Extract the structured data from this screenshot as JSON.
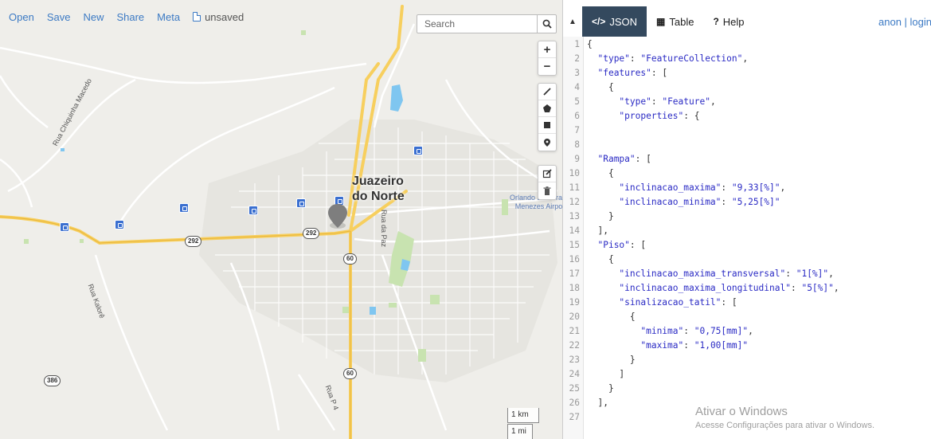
{
  "topbar": {
    "open": "Open",
    "save": "Save",
    "new": "New",
    "share": "Share",
    "meta": "Meta",
    "status": "unsaved"
  },
  "search": {
    "placeholder": "Search"
  },
  "map": {
    "city_line1": "Juazeiro",
    "city_line2": "do Norte",
    "streets": {
      "chiquinha": "Rua Chiquinha Macedo",
      "kalore": "Rua Kalorê",
      "paz": "Rua da Paz",
      "p4": "Rua P 4"
    },
    "place_line1": "Orlando Bezerra de",
    "place_line2": "Menezes Airport",
    "shields": [
      "292",
      "292",
      "60",
      "60",
      "386"
    ],
    "scale_km": "1 km",
    "scale_mi": "1 mi",
    "zoom_in": "+",
    "zoom_out": "−"
  },
  "side": {
    "tabs": [
      {
        "icon": "</>",
        "label": "JSON"
      },
      {
        "icon": "▦",
        "label": "Table"
      },
      {
        "icon": "?",
        "label": "Help"
      }
    ],
    "user": "anon | login"
  },
  "editor_lines": [
    "{",
    "  \"type\": \"FeatureCollection\",",
    "  \"features\": [",
    "    {",
    "      \"type\": \"Feature\",",
    "      \"properties\": {",
    "",
    "",
    "  \"Rampa\": [",
    "    {",
    "      \"inclinacao_maxima\": \"9,33[%]\",",
    "      \"inclinacao_minima\": \"5,25[%]\"",
    "    }",
    "  ],",
    "  \"Piso\": [",
    "    {",
    "      \"inclinacao_maxima_transversal\": \"1[%]\",",
    "      \"inclinacao_maxima_longitudinal\": \"5[%]\",",
    "      \"sinalizacao_tatil\": [",
    "        {",
    "          \"minima\": \"0,75[mm]\",",
    "          \"maxima\": \"1,00[mm]\"",
    "        }",
    "      ]",
    "    }",
    "  ],",
    ""
  ],
  "watermark": {
    "title": "Ativar o Windows",
    "subtitle": "Acesse Configurações para ativar o Windows."
  }
}
